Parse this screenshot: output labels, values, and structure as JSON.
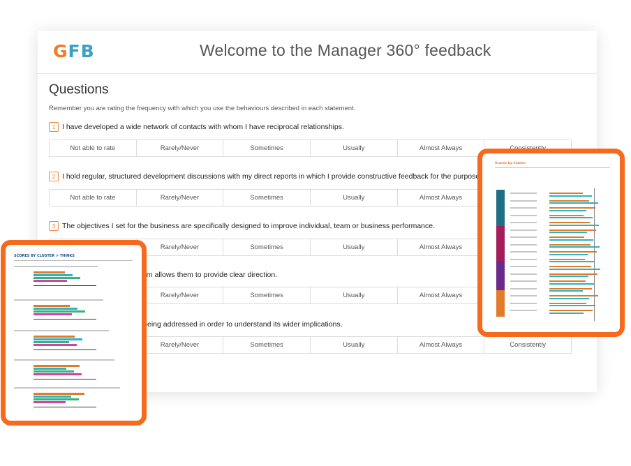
{
  "header": {
    "logo_g": "G",
    "logo_fb": "FB",
    "title": "Welcome to the Manager 360° feedback"
  },
  "main": {
    "section_title": "Questions",
    "instructions": "Remember you are rating the frequency with which you use the behaviours described in each statement.",
    "scale_options": [
      "Not able to rate",
      "Rarely/Never",
      "Sometimes",
      "Usually",
      "Almost Always",
      "Consistently"
    ],
    "questions": [
      {
        "number": "1",
        "text": "I have developed a wide network of contacts with whom I have reciprocal relationships."
      },
      {
        "number": "2",
        "text": "I hold regular, structured development discussions with my direct reports in which I provide constructive feedback for the purposes of personal development."
      },
      {
        "number": "3",
        "text": "The objectives I set for the business are specifically designed to improve individual, team or business performance."
      },
      {
        "number": "",
        "text": "ssions where their specialism allows them to provide clear direction."
      },
      {
        "number": "",
        "text": "ope of the particular issue being addressed in order to understand its wider implications."
      }
    ]
  },
  "reports": {
    "left_title": "SCORES BY CLUSTER > THINKS",
    "right_title": "Scores by Cluster"
  },
  "colors": {
    "accent_orange": "#f56a1d",
    "logo_orange": "#f07c2a",
    "logo_blue": "#3aa0c9",
    "bar_orange": "#e07b2b",
    "bar_teal": "#2bb3c0",
    "bar_pink": "#d93fa8"
  }
}
